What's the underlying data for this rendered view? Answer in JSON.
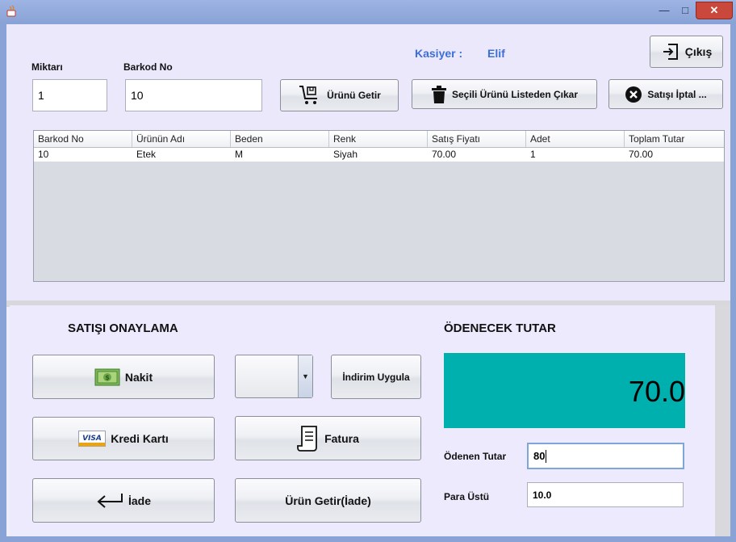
{
  "window": {
    "minimize": "—",
    "maximize": "□",
    "close": "✕"
  },
  "cashier": {
    "label": "Kasiyer  :",
    "name": "Elif"
  },
  "top": {
    "miktar_label": "Miktarı",
    "miktar_value": "1",
    "barkod_label": "Barkod No",
    "barkod_value": "10",
    "urunu_getir": "Ürünü Getir",
    "secili_cikar": "Seçili Ürünü Listeden Çıkar",
    "satis_iptal": "Satışı İptal ...",
    "cikis": "Çıkış"
  },
  "table": {
    "columns": [
      "Barkod No",
      "Ürünün Adı",
      "Beden",
      "Renk",
      "Satış Fiyatı",
      "Adet",
      "Toplam Tutar"
    ],
    "rows": [
      [
        "10",
        "Etek",
        "M",
        "Siyah",
        "70.00",
        "1",
        "70.00"
      ]
    ]
  },
  "bottom": {
    "confirm_title": "SATIŞI ONAYLAMA",
    "nakit": "Nakit",
    "indirim_uygula": "İndirim Uygula",
    "kredi_karti": "Kredi Kartı",
    "fatura": "Fatura",
    "iade": "İade",
    "urun_getir_iade": "Ürün Getir(İade)",
    "odenecek_title": "ÖDENECEK TUTAR",
    "odenecek_value": "70.0",
    "odenen_label": "Ödenen Tutar",
    "odenen_value": "80",
    "para_ustu_label": "Para Üstü",
    "para_ustu_value": "10.0",
    "visa_text": "VISA"
  },
  "colors": {
    "accent_blue": "#3b6fd8",
    "total_bg": "#00b0ae"
  }
}
